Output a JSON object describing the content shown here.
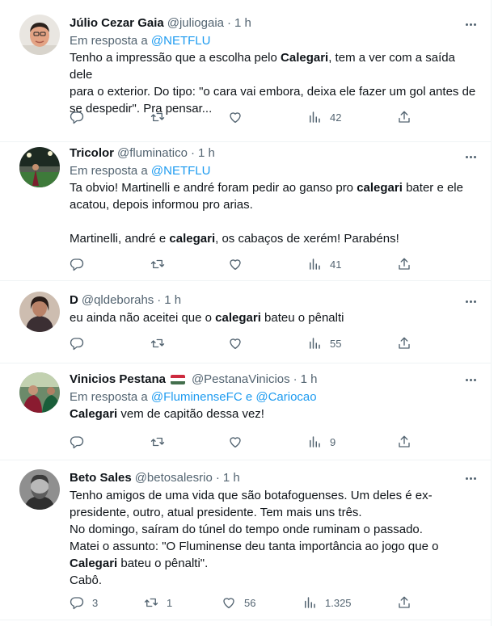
{
  "ui": {
    "in_reply_to": "Em resposta a"
  },
  "tweets": [
    {
      "name": "Júlio Cezar Gaia",
      "handle": "@juliogaia",
      "sep": "·",
      "time": "1 h",
      "reply_to": [
        "@NETFLU"
      ],
      "reply_join": "",
      "lines": [
        [
          {
            "t": "Tenho a impressão que a escolha pelo "
          },
          {
            "t": "Calegari",
            "b": true
          },
          {
            "t": ", tem a ver com a saída dele"
          }
        ],
        [
          {
            "t": "para o exterior. Do tipo: \"o cara vai embora, deixa ele fazer um gol antes de"
          }
        ],
        [
          {
            "t": "se despedir\". Pra pensar..."
          }
        ]
      ],
      "stats": {
        "replies": "",
        "retweets": "",
        "likes": "",
        "views": "42"
      }
    },
    {
      "name": "Tricolor",
      "handle": "@fluminatico",
      "sep": "·",
      "time": "1 h",
      "reply_to": [
        "@NETFLU"
      ],
      "reply_join": "",
      "lines": [
        [
          {
            "t": "Ta obvio! Martinelli e andré foram pedir ao ganso pro "
          },
          {
            "t": "calegari",
            "b": true
          },
          {
            "t": " bater e ele"
          }
        ],
        [
          {
            "t": "acatou, depois informou pro arias."
          }
        ],
        [],
        [
          {
            "t": "Martinelli, andré e "
          },
          {
            "t": "calegari",
            "b": true
          },
          {
            "t": ", os cabaços de xerém! Parabéns!"
          }
        ]
      ],
      "stats": {
        "replies": "",
        "retweets": "",
        "likes": "",
        "views": "41"
      }
    },
    {
      "name": "D",
      "handle": "@qldeborahs",
      "sep": "·",
      "time": "1 h",
      "reply_to": [],
      "reply_join": "",
      "lines": [
        [
          {
            "t": "eu ainda não aceitei que o "
          },
          {
            "t": "calegari",
            "b": true
          },
          {
            "t": " bateu o pênalti"
          }
        ]
      ],
      "stats": {
        "replies": "",
        "retweets": "",
        "likes": "",
        "views": "55"
      }
    },
    {
      "name": "Vinicios Pestana",
      "handle": "@PestanaVinicios",
      "sep": "·",
      "time": "1 h",
      "reply_to": [
        "@FluminenseFC",
        "@Cariocao"
      ],
      "reply_join": "e",
      "lines": [
        [
          {
            "t": "Calegari",
            "b": true
          },
          {
            "t": " vem de capitão dessa vez!"
          }
        ]
      ],
      "stats": {
        "replies": "",
        "retweets": "",
        "likes": "",
        "views": "9"
      }
    },
    {
      "name": "Beto Sales",
      "handle": "@betosalesrio",
      "sep": "·",
      "time": "1 h",
      "reply_to": [],
      "reply_join": "",
      "lines": [
        [
          {
            "t": "Tenho amigos de uma vida que são botafoguenses. Um deles é ex-"
          }
        ],
        [
          {
            "t": "presidente, outro, atual presidente. Tem mais uns três."
          }
        ],
        [
          {
            "t": "No domingo, saíram do túnel do tempo onde ruminam o passado."
          }
        ],
        [
          {
            "t": "Matei o assunto: \"O Fluminense deu tanta importância ao jogo que o"
          }
        ],
        [
          {
            "t": "Calegari",
            "b": true
          },
          {
            "t": " bateu o pênalti\"."
          }
        ],
        [
          {
            "t": "Cabô."
          }
        ]
      ],
      "stats": {
        "replies": "3",
        "retweets": "1",
        "likes": "56",
        "views": "1.325"
      }
    }
  ],
  "icons": [
    "more-icon",
    "reply-icon",
    "retweet-icon",
    "like-icon",
    "views-icon",
    "share-icon",
    "flag-icon"
  ],
  "colors": {
    "link": "#1d9bf0",
    "secondary": "#536471",
    "text": "#0f1419",
    "divider": "#eff3f4"
  }
}
